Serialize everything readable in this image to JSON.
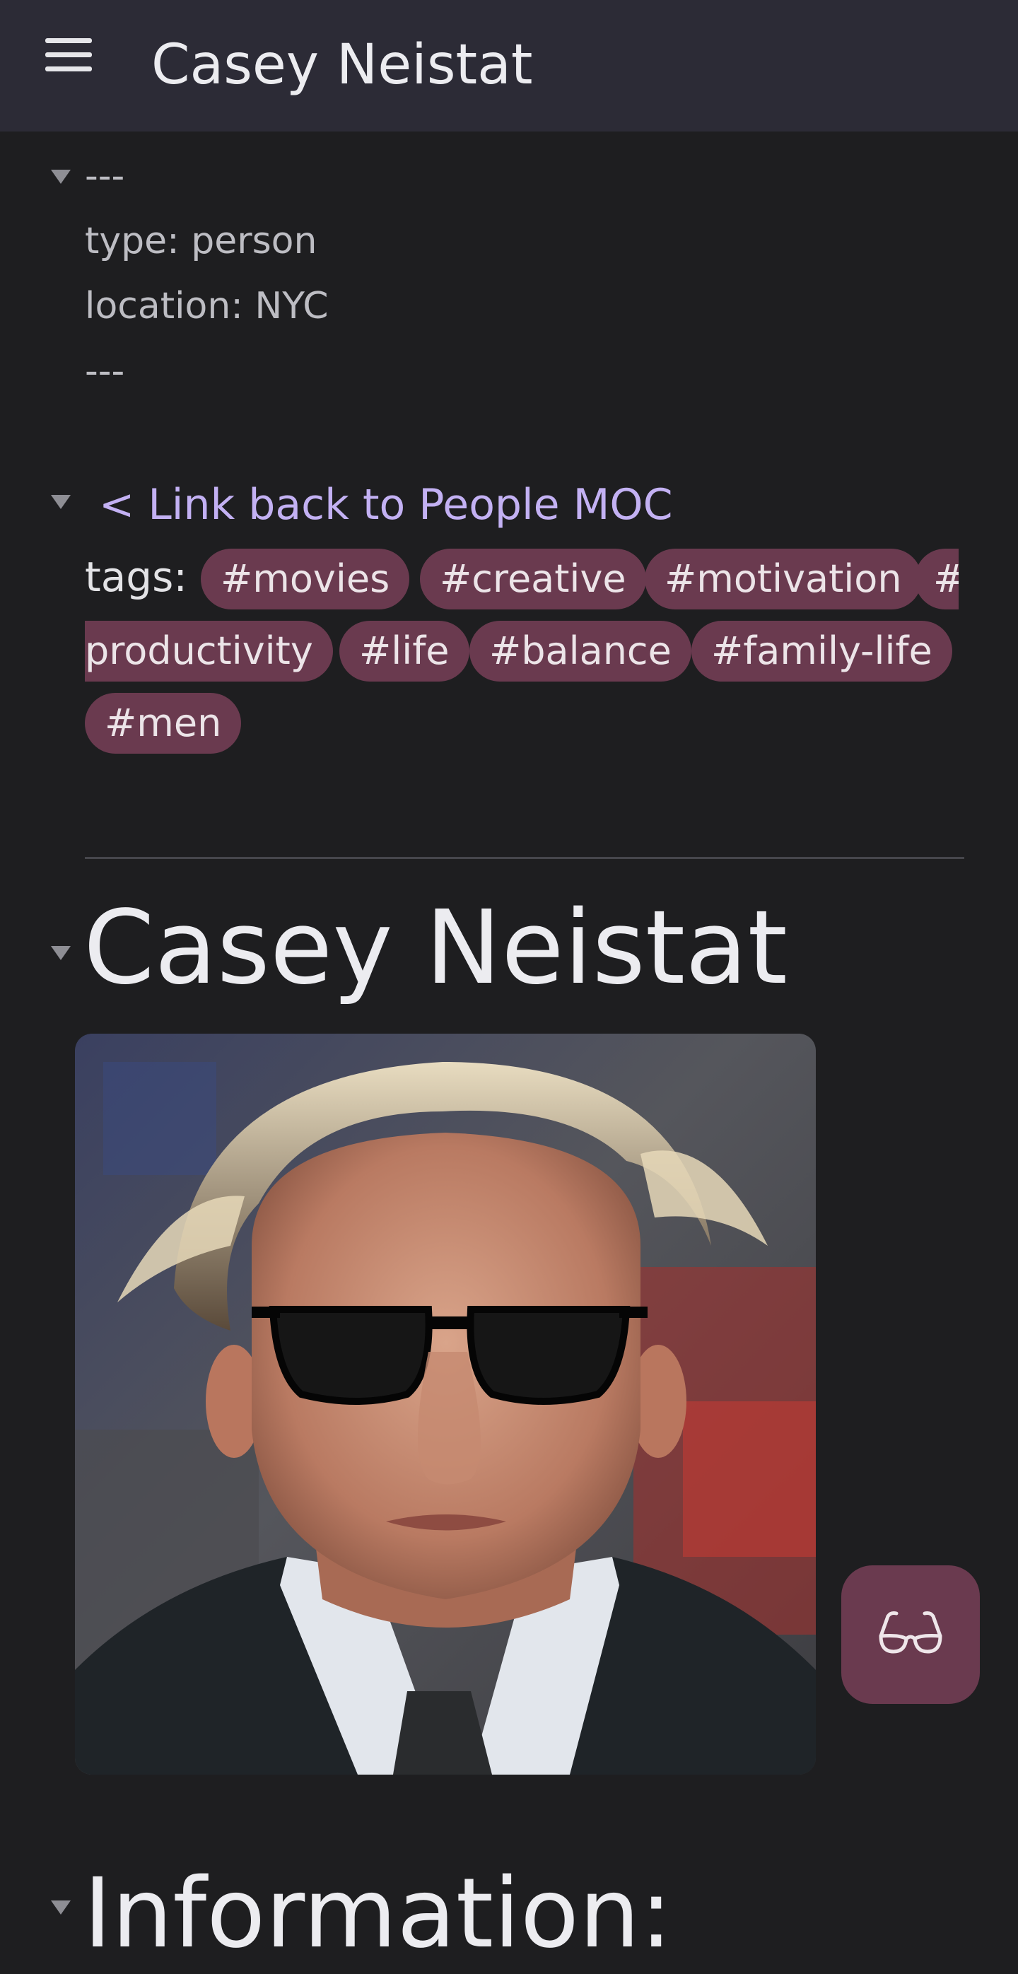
{
  "header": {
    "menu_icon": "hamburger-menu-icon",
    "title": "Casey Neistat"
  },
  "frontmatter": {
    "open_delim": "---",
    "lines": [
      "type: person",
      "location: NYC"
    ],
    "close_delim": "---"
  },
  "backlink": {
    "text": "< Link back to People MOC"
  },
  "tags": {
    "label": "tags:",
    "items": [
      "#movies",
      "#creative",
      "#motivation",
      "#productivity",
      "#life",
      "#balance",
      "#family-life",
      "#men"
    ],
    "wrapped_parts": [
      "#",
      "productivity"
    ]
  },
  "heading": {
    "title": "Casey Neistat"
  },
  "next_heading": {
    "title": "Information:"
  },
  "reading_mode_button": {
    "icon": "glasses-icon"
  },
  "colors": {
    "background": "#1e1e20",
    "topbar": "#2c2b36",
    "accent_link": "#c3b1f3",
    "tag_bg": "#6a3a4f"
  }
}
